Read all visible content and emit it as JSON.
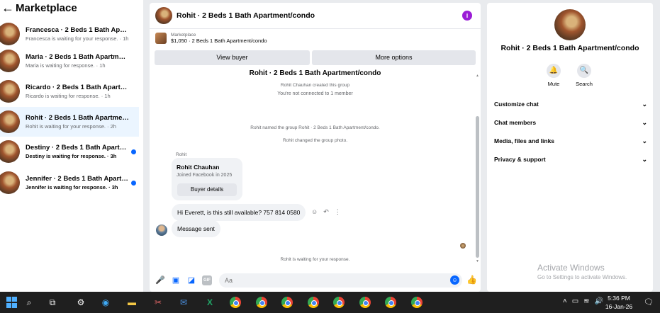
{
  "sidebar": {
    "back_icon": "←",
    "title": "Marketplace",
    "conversations": [
      {
        "title": "Francesca · 2 Beds 1 Bath Apartment/condo",
        "subtitle": "Francesca is waiting for your response. · 1h",
        "unread": false,
        "active": false
      },
      {
        "title": "Maria · 2 Beds 1 Bath Apartment/condo",
        "subtitle": "Maria is waiting for response. · 1h",
        "unread": false,
        "active": false
      },
      {
        "title": "Ricardo · 2 Beds 1 Bath Apartment/condo",
        "subtitle": "Ricardo is waiting for response. · 1h",
        "unread": false,
        "active": false
      },
      {
        "title": "Rohit · 2 Beds 1 Bath Apartment/condo",
        "subtitle": "Rohit is waiting for your response. · 2h",
        "unread": false,
        "active": true
      },
      {
        "title": "Destiny · 2 Beds 1 Bath Apartment/condo",
        "subtitle": "Destiny is waiting for response. · 3h",
        "unread": true,
        "active": false
      },
      {
        "title": "Jennifer · 2 Beds 1 Bath Apartment/condo",
        "subtitle": "Jennifer is waiting for response. · 3h",
        "unread": true,
        "active": false
      }
    ]
  },
  "chat": {
    "header_title": "Rohit · 2 Beds 1 Bath Apartment/condo",
    "info_icon": "i",
    "listing": {
      "label": "Marketplace",
      "price_title": "$1,050 · 2 Beds 1 Bath Apartment/condo"
    },
    "view_buyer_label": "View buyer",
    "more_options_label": "More options",
    "thread": {
      "group_title": "Rohit · 2 Beds 1 Bath Apartment/condo",
      "created": "Rohit Chauhan created this group",
      "not_connected": "You're not connected to 1 member",
      "named": "Rohit named the group Rohit · 2 Beds 1 Bath Apartment/condo.",
      "changed_photo": "Rohit changed the group photo.",
      "sender": "Rohit",
      "card_name": "Rohit Chauhan",
      "card_sub": "Joined Facebook in 2025",
      "card_button": "Buyer details",
      "message1": "Hi Everett, is this still available? 757 814 0580",
      "message2": "Message sent",
      "waiting": "Rohit is waiting for your response."
    },
    "composer": {
      "placeholder": "Aa"
    }
  },
  "right_panel": {
    "title": "Rohit · 2 Beds 1 Bath Apartment/condo",
    "mute_label": "Mute",
    "search_label": "Search",
    "sections": [
      "Customize chat",
      "Chat members",
      "Media, files and links",
      "Privacy & support"
    ],
    "activate_title": "Activate Windows",
    "activate_sub": "Go to Settings to activate Windows."
  },
  "taskbar": {
    "time": "5:36 PM",
    "date": "16-Jan-26"
  },
  "colors": {
    "accent": "#0866ff",
    "info": "#9b1cd6",
    "bubble": "#f0f2f5"
  }
}
